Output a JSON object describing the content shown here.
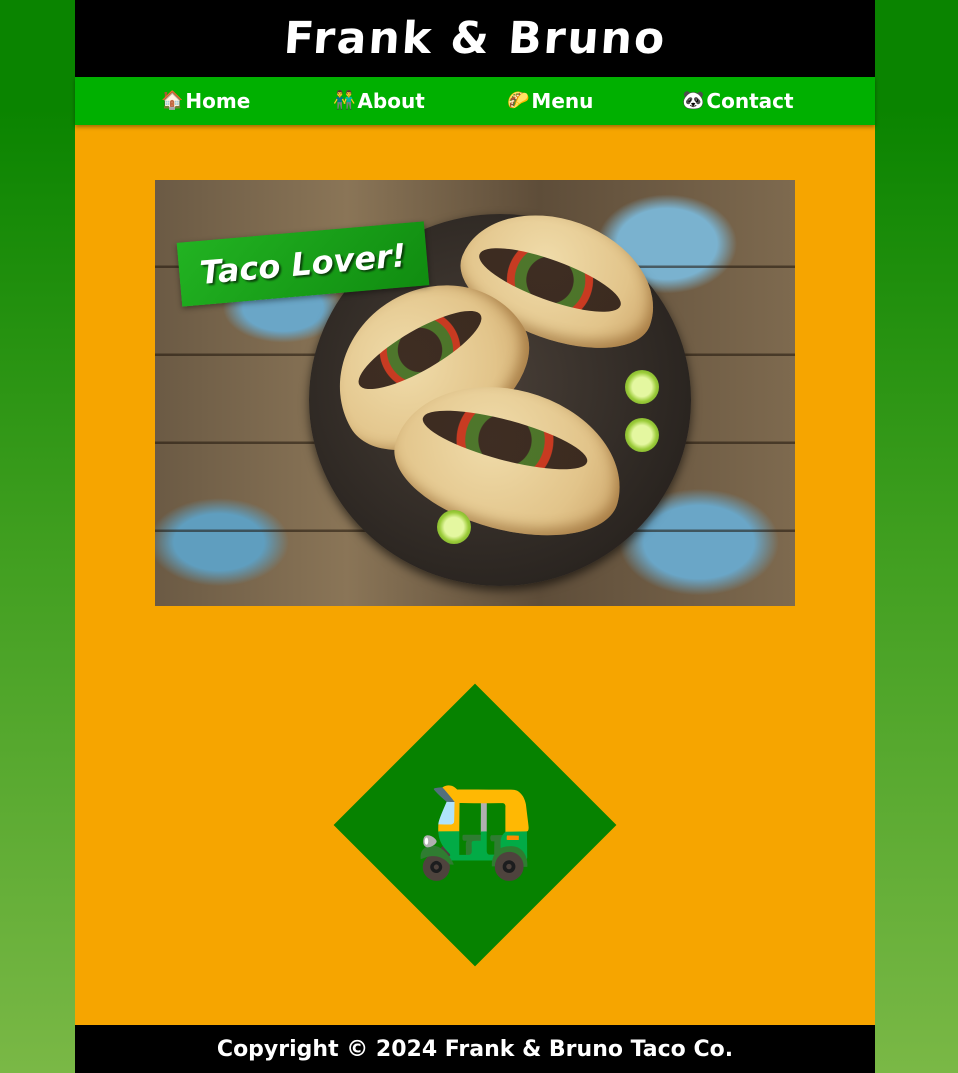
{
  "header": {
    "title": "Frank & Bruno"
  },
  "nav": {
    "items": [
      {
        "label": "Home",
        "icon": "🏠",
        "icon_name": "house-icon"
      },
      {
        "label": "About",
        "icon": "👬",
        "icon_name": "two-men-icon"
      },
      {
        "label": "Menu",
        "icon": "🌮",
        "icon_name": "taco-icon"
      },
      {
        "label": "Contact",
        "icon": "🐼",
        "icon_name": "panda-icon"
      }
    ]
  },
  "hero": {
    "badge_text": "Taco Lover!"
  },
  "feature": {
    "icon": "🛺",
    "icon_name": "auto-rickshaw-icon"
  },
  "footer": {
    "copyright": "Copyright © 2024 Frank & Bruno Taco Co."
  },
  "colors": {
    "background_top": "#0a8400",
    "background_bottom": "#7ab846",
    "page": "#f6a500",
    "header": "#000000",
    "nav": "#00b000",
    "diamond": "#068200"
  }
}
